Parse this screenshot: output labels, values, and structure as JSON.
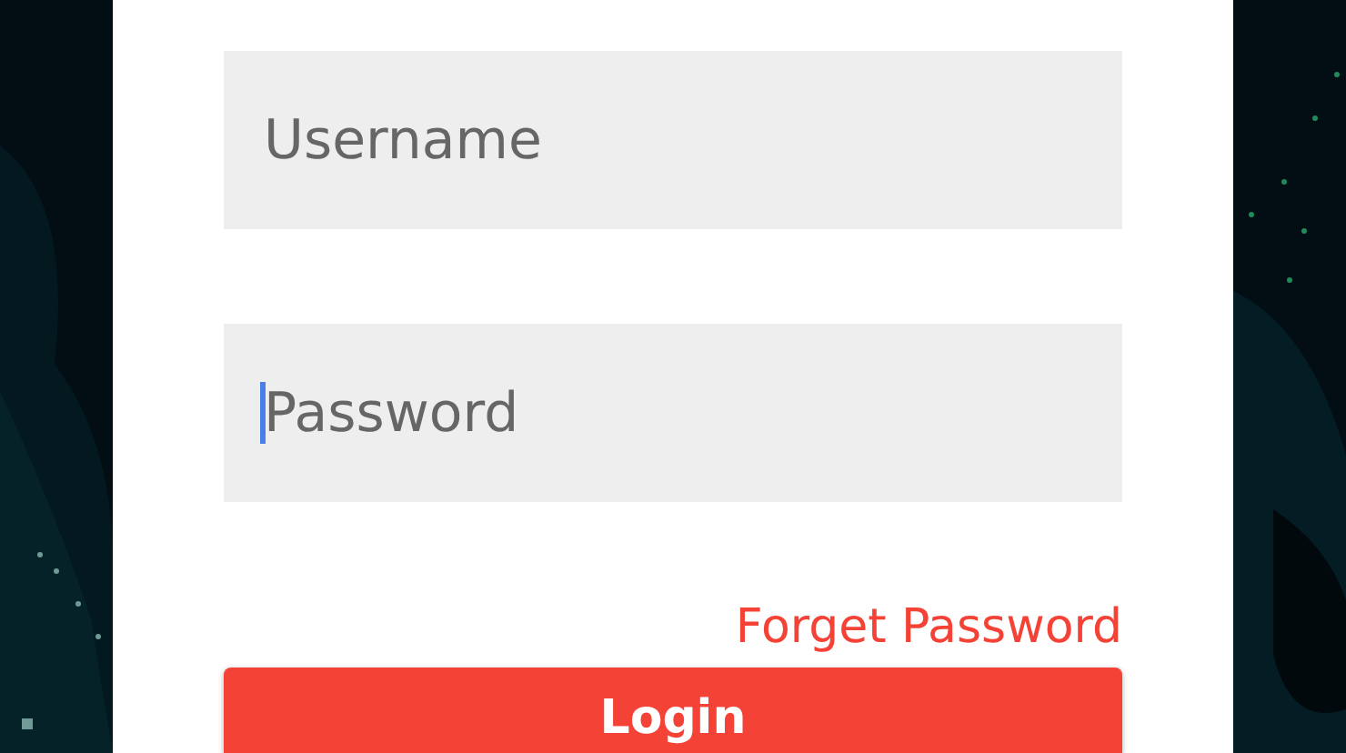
{
  "fields": [
    {
      "placeholder": "Username",
      "focused": false
    },
    {
      "placeholder": "Password",
      "focused": true
    }
  ],
  "forgot_link": "Forget Password",
  "login_button": "Login"
}
